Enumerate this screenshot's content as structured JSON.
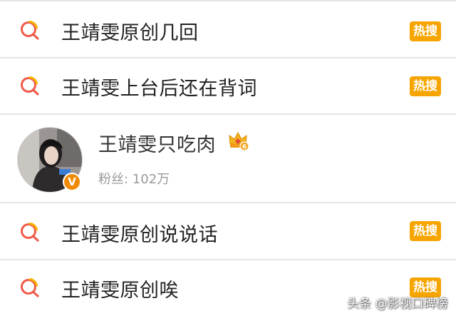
{
  "results": [
    {
      "text": "王靖雯原创几回",
      "badge": "热搜",
      "icon": "search-icon"
    },
    {
      "text": "王靖雯上台后还在背词",
      "badge": "热搜",
      "icon": "search-icon"
    },
    {
      "text": "王靖雯原创说说话",
      "badge": "热搜",
      "icon": "search-icon"
    },
    {
      "text": "王靖雯原创唉",
      "badge": "热搜",
      "icon": "search-icon"
    }
  ],
  "user": {
    "name": "王靖雯只吃肉",
    "followers": "粉丝: 102万",
    "verified_mark": "V",
    "level": "6",
    "icons": [
      "avatar",
      "verified-badge",
      "crown-icon"
    ]
  },
  "watermark": "头条 @影视口碑榜",
  "colors": {
    "badge": "#f6a500",
    "verified": "#f08a00",
    "text": "#222222",
    "muted": "#999999",
    "divider": "#e4e4e4"
  }
}
